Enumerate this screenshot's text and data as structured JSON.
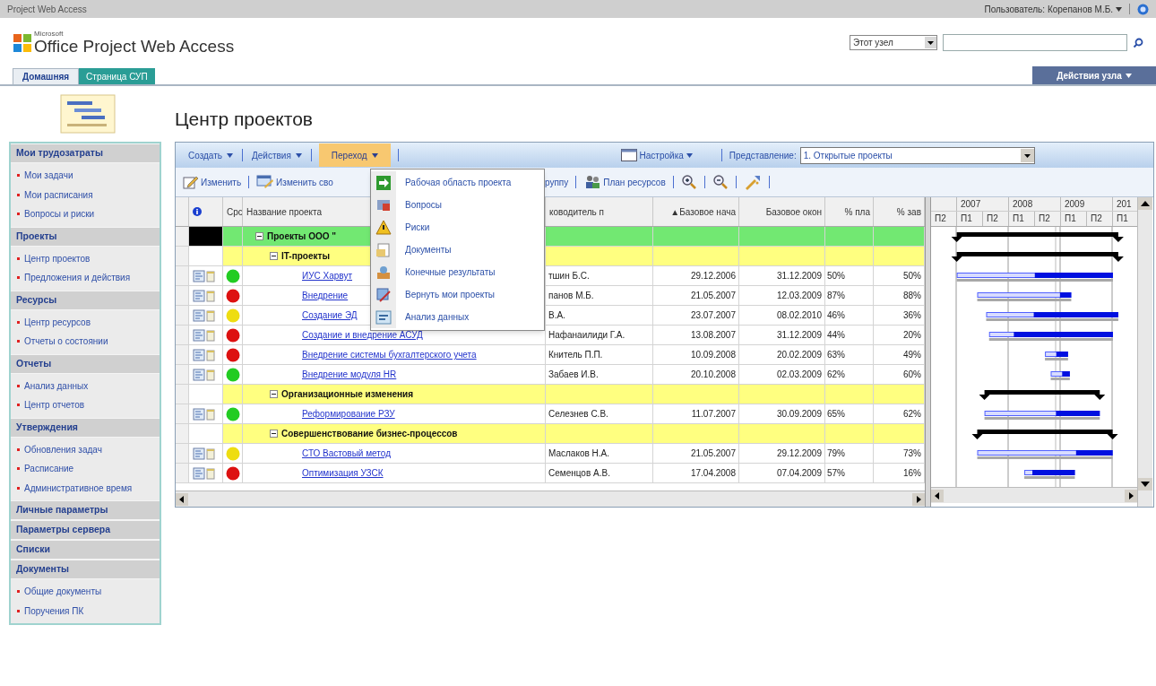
{
  "top_bar": {
    "title": "Project Web Access",
    "user": "Пользователь: Корепанов М.Б."
  },
  "header": {
    "logo_small": "Microsoft",
    "logo": "Office Project Web Access",
    "scope": "Этот узел"
  },
  "tabs": [
    {
      "label": "Домашняя",
      "selected": true
    },
    {
      "label": "Страница СУП",
      "selected": false
    }
  ],
  "site_actions": "Действия узла",
  "page_title": "Центр проектов",
  "sidebar": [
    {
      "heading": "Мои трудозатраты",
      "items": [
        "Мои задачи",
        "Мои расписания",
        "Вопросы и риски"
      ]
    },
    {
      "heading": "Проекты",
      "items": [
        "Центр проектов",
        "Предложения и действия"
      ]
    },
    {
      "heading": "Ресурсы",
      "items": [
        "Центр ресурсов",
        "Отчеты о состоянии"
      ]
    },
    {
      "heading": "Отчеты",
      "items": [
        "Анализ данных",
        "Центр отчетов"
      ]
    },
    {
      "heading": "Утверждения",
      "items": [
        "Обновления задач",
        "Расписание",
        "Административное время"
      ]
    },
    {
      "heading": "Личные параметры"
    },
    {
      "heading": "Параметры сервера"
    },
    {
      "heading": "Списки"
    },
    {
      "heading": "Документы",
      "items": [
        "Общие документы",
        "Поручения ПК"
      ]
    }
  ],
  "toolbar": {
    "menus": [
      {
        "label": "Создать",
        "open": false
      },
      {
        "label": "Действия",
        "open": false
      },
      {
        "label": "Переход",
        "open": true
      }
    ],
    "settings": "Настройка",
    "view_label": "Представление:",
    "view": "1. Открытые проекты"
  },
  "actions_left": [
    {
      "kind": "edit",
      "label": "Изменить"
    },
    {
      "kind": "properties",
      "label": "Изменить сво"
    }
  ],
  "actions_right": [
    {
      "kind": "text",
      "label": "руппу"
    },
    {
      "kind": "resources",
      "label": "План ресурсов"
    },
    {
      "kind": "zoom_in"
    },
    {
      "kind": "zoom_out"
    },
    {
      "kind": "filter"
    }
  ],
  "menu": [
    {
      "kind": "workspace",
      "label": "Рабочая область проекта"
    },
    {
      "kind": "issues",
      "label": "Вопросы"
    },
    {
      "kind": "risks",
      "label": "Риски"
    },
    {
      "kind": "documents",
      "label": "Документы"
    },
    {
      "kind": "deliverables",
      "label": "Конечные результаты"
    },
    {
      "kind": "checkin",
      "label": "Вернуть мои проекты"
    },
    {
      "kind": "analysis",
      "label": "Анализ данных"
    }
  ],
  "grid": {
    "columns": [
      "Срс",
      "Название проекта",
      "ководитель п",
      "▲Базовое нача",
      "Базовое окон",
      "% пла",
      "% зав"
    ],
    "rows": [
      {
        "kind": "group",
        "name": "Проекты ООО \"",
        "expanded": true,
        "children": [
          {
            "kind": "group",
            "name": "IT-проекты",
            "expanded": true,
            "children": [
              {
                "kind": "project",
                "name": "ИУС Харвут",
                "manager": "тшин Б.С.",
                "start": "29.12.2006",
                "finish": "31.12.2009",
                "planned": "50%",
                "complete": "50%",
                "color": "#22cc22"
              },
              {
                "kind": "project",
                "name": "Внедрение",
                "manager": "панов М.Б.",
                "start": "21.05.2007",
                "finish": "12.03.2009",
                "planned": "87%",
                "complete": "88%",
                "color": "#dd1111"
              },
              {
                "kind": "project",
                "name": "Создание ЭД",
                "manager": "В.А.",
                "start": "23.07.2007",
                "finish": "08.02.2010",
                "planned": "46%",
                "complete": "36%",
                "color": "#eedd11"
              },
              {
                "kind": "project",
                "name": "Создание и внедрение АСУД",
                "manager": "Нафанаилиди Г.А.",
                "start": "13.08.2007",
                "finish": "31.12.2009",
                "planned": "44%",
                "complete": "20%",
                "color": "#dd1111"
              },
              {
                "kind": "project",
                "name": "Внедрение системы бухгалтерского учета",
                "manager": "Книтель П.П.",
                "start": "10.09.2008",
                "finish": "20.02.2009",
                "planned": "63%",
                "complete": "49%",
                "color": "#dd1111"
              },
              {
                "kind": "project",
                "name": "Внедрение модуля HR",
                "manager": "Забаев И.В.",
                "start": "20.10.2008",
                "finish": "02.03.2009",
                "planned": "62%",
                "complete": "60%",
                "color": "#22cc22"
              }
            ]
          },
          {
            "kind": "group",
            "name": "Организационные изменения",
            "expanded": true,
            "children": [
              {
                "kind": "project",
                "name": "Реформирование РЗУ",
                "manager": "Селезнев С.В.",
                "start": "11.07.2007",
                "finish": "30.09.2009",
                "planned": "65%",
                "complete": "62%",
                "color": "#22cc22"
              }
            ]
          },
          {
            "kind": "group",
            "name": "Совершенствование бизнес-процессов",
            "expanded": true,
            "children": [
              {
                "kind": "project",
                "name": "СТО Вастовый метод",
                "manager": "Маслаков Н.А.",
                "start": "21.05.2007",
                "finish": "29.12.2009",
                "planned": "79%",
                "complete": "73%",
                "color": "#eedd11"
              },
              {
                "kind": "project",
                "name": "Оптимизация УЗСК",
                "manager": "Семенцов А.В.",
                "start": "17.04.2008",
                "finish": "07.04.2009",
                "planned": "57%",
                "complete": "16%",
                "color": "#dd1111"
              }
            ]
          }
        ]
      }
    ]
  },
  "gantt": {
    "years": [
      "2007",
      "2008",
      "2009",
      "201"
    ],
    "halves": [
      "П2",
      "П1",
      "П2",
      "П1",
      "П2",
      "П1",
      "П2",
      "П1"
    ]
  }
}
